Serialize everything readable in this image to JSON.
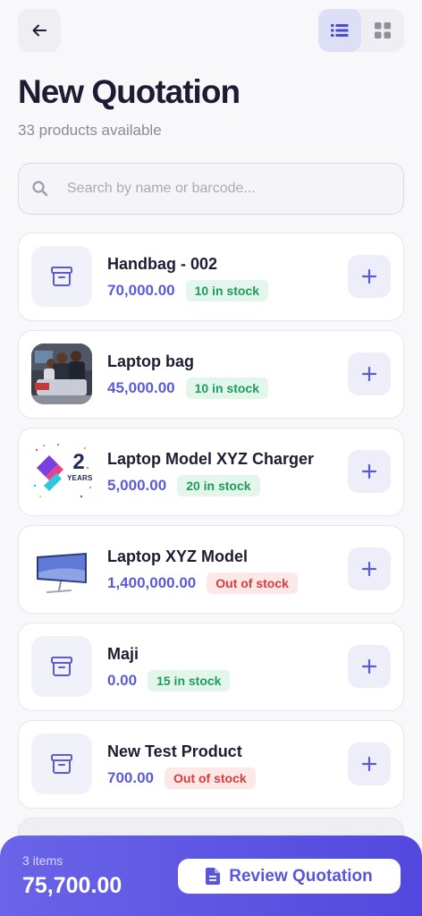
{
  "header": {
    "title": "New Quotation",
    "subtitle": "33 products available",
    "back_icon": "arrow-left-icon",
    "view_options": [
      "list-view-icon",
      "grid-view-icon"
    ]
  },
  "search": {
    "placeholder": "Search by name or barcode...",
    "value": ""
  },
  "products": [
    {
      "name": "Handbag - 002",
      "price": "70,000.00",
      "stock": "10 in stock",
      "stock_status": "in",
      "thumb": "archive-box-icon"
    },
    {
      "name": "Laptop bag",
      "price": "45,000.00",
      "stock": "10 in stock",
      "stock_status": "in",
      "thumb": "product-photo"
    },
    {
      "name": "Laptop Model XYZ Charger",
      "price": "5,000.00",
      "stock": "20 in stock",
      "stock_status": "in",
      "thumb": "product-photo"
    },
    {
      "name": "Laptop XYZ Model",
      "price": "1,400,000.00",
      "stock": "Out of stock",
      "stock_status": "out",
      "thumb": "product-photo"
    },
    {
      "name": "Maji",
      "price": "0.00",
      "stock": "15 in stock",
      "stock_status": "in",
      "thumb": "archive-box-icon"
    },
    {
      "name": "New Test Product",
      "price": "700.00",
      "stock": "Out of stock",
      "stock_status": "out",
      "thumb": "archive-box-icon"
    }
  ],
  "warranty_badge": {
    "number": "2",
    "unit": "YEARS"
  },
  "cart": {
    "items_label": "3 items",
    "total": "75,700.00",
    "review_label": "Review Quotation",
    "review_icon": "document-icon"
  },
  "colors": {
    "accent": "#5b5bd6",
    "in_stock": "#1f9a5e",
    "out_of_stock": "#dc3b3b",
    "bar_start": "#6a64e8",
    "bar_end": "#5248df"
  }
}
